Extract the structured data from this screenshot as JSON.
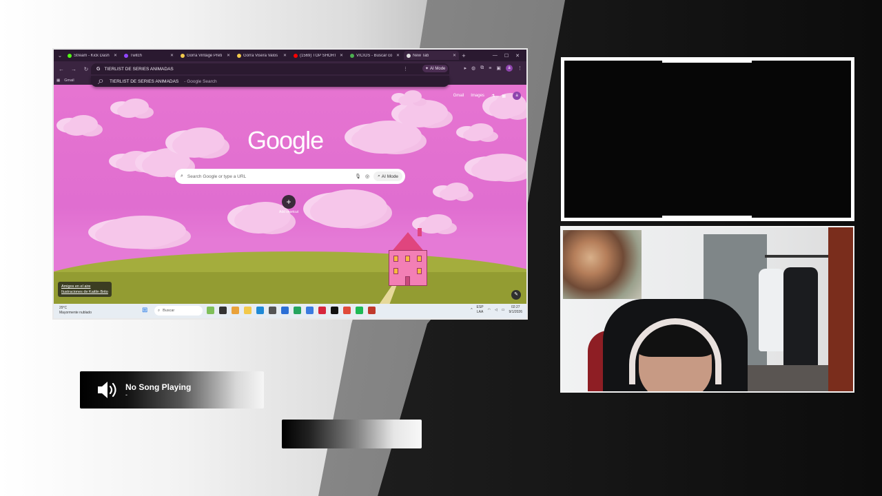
{
  "browser": {
    "tabs": [
      {
        "label": "Stream - Kick Dash",
        "color": "#53fc18"
      },
      {
        "label": "Twitch",
        "color": "#9146ff"
      },
      {
        "label": "Gorra Vintage Preti",
        "color": "#f2c94c"
      },
      {
        "label": "Gorra Visera Valos",
        "color": "#f2c94c"
      },
      {
        "label": "(1569) TOP SHORT",
        "color": "#ff0000"
      },
      {
        "label": "VICIOS - Buscar co",
        "color": "#4caf50"
      },
      {
        "label": "New Tab",
        "color": "#e0e0e0"
      }
    ],
    "omnibox_value": "TIERLIST DE SERIES ANIMADAS",
    "ai_mode_label": "AI Mode",
    "suggestion_query": "TIERLIST DE SERIES ANIMADAS",
    "suggestion_suffix": "- Google Search",
    "bookmark_gmail": "Gmail",
    "page": {
      "gmail_link": "Gmail",
      "images_link": "Images",
      "account_initial": "a",
      "logo_text": "Google",
      "search_placeholder": "Search Google or type a URL",
      "search_ai_mode": "AI Mode",
      "add_shortcut": "+",
      "add_shortcut_label": "Add shortcut",
      "credit_title": "Amigos en el aire",
      "credit_subtitle": "Ilustraciones de Kaitlin Brito"
    },
    "taskbar": {
      "weather_temp": "29°C",
      "weather_desc": "Mayormente nublado",
      "search_label": "Buscar",
      "lang_top": "ESP",
      "lang_bottom": "LAA",
      "time": "02:27",
      "date": "9/1/2026"
    }
  },
  "music": {
    "title": "No Song Playing",
    "artist": "-"
  },
  "colors": {
    "page_pink": "#e06ed0",
    "cloud_pink": "#f6c6ea",
    "grass": "#a4ad3d",
    "taskbar": "#e7edf3"
  }
}
